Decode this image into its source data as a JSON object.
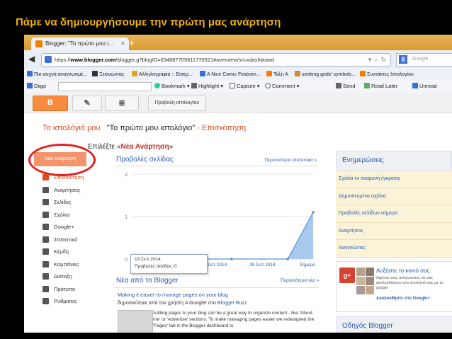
{
  "slide": {
    "title": "Πάμε να δημιουργήσουμε την πρώτη μας ανάρτηση"
  },
  "browser": {
    "tab_title": "Blogger: \"Το πρώτο μου ι...",
    "tab_close": "×",
    "new_tab": "+",
    "url_prefix": "https://",
    "url_host": "www.blogger.com",
    "url_rest": "/blogger.g?blogID=634887705611770521#overview/src=dashboard",
    "search_placeholder": "Google",
    "bookmarks": [
      {
        "label": "Πιο συχνά αναγνωσμέ...",
        "color": "#3a6fd8"
      },
      {
        "label": "Ξεκινώντας",
        "color": "#333"
      },
      {
        "label": "Αλληλογραφία :: Εισερ...",
        "color": "#e0a020"
      },
      {
        "label": "A Nice Comic Featurin...",
        "color": "#3a6fd8"
      },
      {
        "label": "Τάξη Α",
        "color": "#f57d00"
      },
      {
        "label": "seeking gods' symbols...",
        "color": "#c84"
      },
      {
        "label": "Συντάκτες Ιστολογίου",
        "color": "#f57d00"
      }
    ],
    "toolbar_items": [
      {
        "label": "Diigo",
        "color": "#3a6fd8"
      },
      {
        "label": "Bookmark ▾",
        "color": "#3c9"
      },
      {
        "label": "Highlight ▾",
        "color": "#666"
      },
      {
        "label": "Capture ▾",
        "color": "#666"
      },
      {
        "label": "Comment ▾",
        "color": "#666"
      },
      {
        "label": "Send",
        "color": "#666"
      },
      {
        "label": "Read Later",
        "color": "#666"
      },
      {
        "label": "Unread",
        "color": "#666"
      }
    ]
  },
  "blogger": {
    "view_blog": "Προβολή ιστολογίου",
    "heading_my_blogs": "Τα ιστολόγιά μου",
    "heading_blog": "\"Το πρώτο μου ιστολόγιο\"",
    "heading_sep": "·",
    "heading_overview": "Επισκόπηση",
    "new_post": "Νέα ανάρτηση",
    "nav": [
      {
        "label": "Επισκόπηση",
        "icon": "overview-icon",
        "active": true
      },
      {
        "label": "Αναρτήσεις",
        "icon": "posts-icon",
        "active": false
      },
      {
        "label": "Σελίδες",
        "icon": "pages-icon",
        "active": false
      },
      {
        "label": "Σχόλια",
        "icon": "comments-icon",
        "active": false
      },
      {
        "label": "Google+",
        "icon": "googleplus-icon",
        "active": false
      },
      {
        "label": "Στατιστικά",
        "icon": "stats-icon",
        "active": false
      },
      {
        "label": "Κέρδη",
        "icon": "earnings-icon",
        "active": false
      },
      {
        "label": "Καμπάνιες",
        "icon": "campaigns-icon",
        "active": false
      },
      {
        "label": "Διάταξη",
        "icon": "layout-icon",
        "active": false
      },
      {
        "label": "Πρότυπο",
        "icon": "template-icon",
        "active": false
      },
      {
        "label": "Ρυθμίσεις",
        "icon": "settings-icon",
        "active": false
      }
    ],
    "annotation_prefix": "Επιλέξτε «",
    "annotation_bold": "Νέα Ανάρτηση",
    "annotation_suffix": "»",
    "stats_title": "Προβολές σελίδας",
    "stats_more": "Περισσότερα στατιστικά »",
    "tooltip_date": "19 Σεπ 2014",
    "tooltip_value": "Προβολές σελίδας: 0",
    "news_title": "Νέα από το Blogger",
    "news_more": "Περισσότερα νέα »",
    "news_link": "Making it easier to manage pages on your blog",
    "news_by_prefix": "δημοσιεύτηκε από τον χρήστη A Googler στο ",
    "news_by_link": "Blogger Buzz",
    "news_body": "Adding pages to your blog can be a great way to organize content - like 'About me' or 'Advertise' sections. To make managing pages easier we redesigned the 'Pages' tab in the Blogger dashboard to",
    "right_head": "Ενημερώσεις",
    "right_items": [
      "Σχόλια εν αναμονή έγκρισης",
      "Δημοσιευμένα σχόλια",
      "Προβολές σελίδων σήμερα",
      "Αναρτήσεις",
      "Αναγνώστες"
    ],
    "promo_title": "Αυξήστε το κοινό σας",
    "promo_body": "Αφήστε τους αναγνώστες να σας ακολουθήσουν στο ιστολόγιό σας με το gadget",
    "promo_link": "Ακολουθήστε στο Google+",
    "guide_title": "Οδηγός Blogger"
  },
  "chart_data": {
    "type": "area",
    "title": "Προβολές σελίδας",
    "x": [
      "19 Σεπ 2014",
      "3 Σεπ 2014",
      "25 Σεπ 2014",
      "Σήμερα"
    ],
    "yticks": [
      0,
      1,
      2
    ],
    "ylim": [
      0,
      2
    ],
    "series": [
      {
        "values": [
          0,
          0,
          0,
          1.1
        ]
      }
    ],
    "accent": "#a9c9ee"
  }
}
